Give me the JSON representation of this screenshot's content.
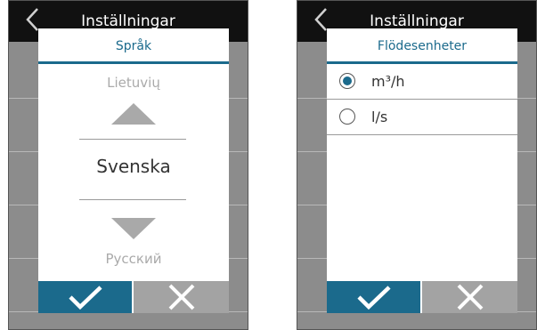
{
  "background_screen": {
    "title": "Inställningar"
  },
  "left_dialog": {
    "title": "Språk",
    "previous_option": "Lietuvių",
    "current_option": "Svenska",
    "next_option": "Русский"
  },
  "right_dialog": {
    "title": "Flödesenheter",
    "options": [
      {
        "label": "m³/h",
        "selected": true
      },
      {
        "label": "l/s",
        "selected": false
      }
    ]
  },
  "icons": {
    "back": "chevron-left-icon",
    "confirm": "check-icon",
    "cancel": "close-icon",
    "scroll_up": "triangle-up-icon",
    "scroll_down": "triangle-down-icon"
  },
  "colors": {
    "accent": "#1b6a8c",
    "cancel_button": "#a3a3a3",
    "header_bg": "#111111",
    "list_bg": "#8c8c8c"
  }
}
